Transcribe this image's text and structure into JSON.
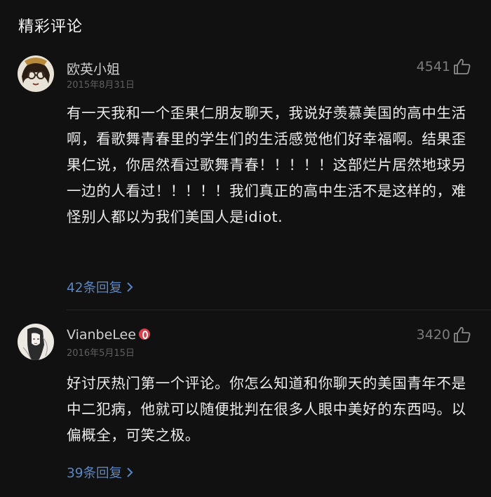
{
  "section": {
    "title": "精彩评论"
  },
  "comments": [
    {
      "username": "欧英小姐",
      "date": "2015年8月31日",
      "likes": "4541",
      "content": "有一天我和一个歪果仁朋友聊天，我说好羡慕美国的高中生活啊，看歌舞青春里的学生们的生活感觉他们好幸福啊。结果歪果仁说，你居然看过歌舞青春！！！！！这部烂片居然地球另一边的人看过！！！！！我们真正的高中生活不是这样的，难怪别人都以为我们美国人是idiot.",
      "replies": "42条回复",
      "avatar_icon": "cartoon-avatar-icon"
    },
    {
      "username": "VianbeLee",
      "date": "2016年5月15日",
      "likes": "3420",
      "content": "好讨厌热门第一个评论。你怎么知道和你聊天的美国青年不是中二犯病，他就可以随便批判在很多人眼中美好的东西吗。以偏概全，可笑之极。",
      "replies": "39条回复",
      "badge_icon": "music-badge-icon",
      "avatar_icon": "sketch-avatar-icon"
    }
  ],
  "colors": {
    "background": "#111111",
    "reply_link": "#5a86c2",
    "badge": "#d8404a"
  }
}
